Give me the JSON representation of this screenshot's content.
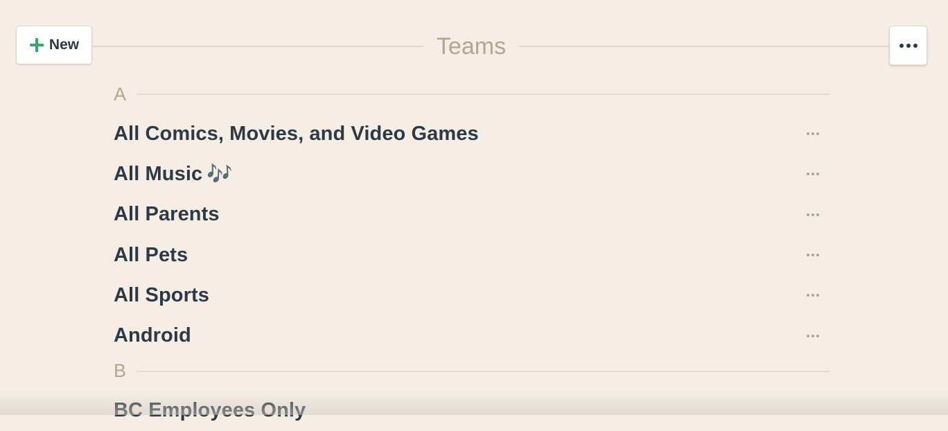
{
  "header": {
    "new_button_label": "New",
    "title": "Teams"
  },
  "colors": {
    "background": "#f6eee4",
    "accent_green": "#3aa66d",
    "text_dark": "#2b3a45",
    "text_muted": "#b3a68e"
  },
  "icons": {
    "new": "plus-icon",
    "header_more": "more-horizontal-icon",
    "row_more": "more-horizontal-icon"
  },
  "sections": [
    {
      "letter": "A",
      "teams": [
        {
          "name": "All Comics, Movies, and Video Games",
          "emoji": ""
        },
        {
          "name": "All Music",
          "emoji": "🎶"
        },
        {
          "name": "All Parents",
          "emoji": ""
        },
        {
          "name": "All Pets",
          "emoji": ""
        },
        {
          "name": "All Sports",
          "emoji": ""
        },
        {
          "name": "Android",
          "emoji": ""
        }
      ]
    },
    {
      "letter": "B",
      "teams": [
        {
          "name": "BC Employees Only",
          "emoji": ""
        }
      ]
    }
  ]
}
